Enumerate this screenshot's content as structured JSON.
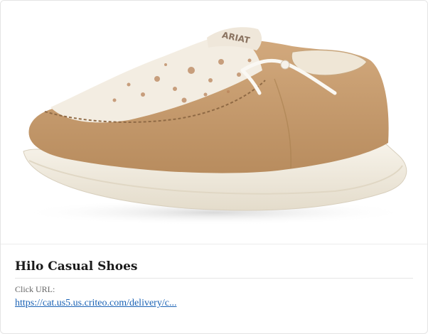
{
  "product": {
    "image_alt": "Ariat Hilo casual shoe, tan suede with cowhide print vamp and white sole",
    "image_brand_text": "ARIAT",
    "title": "Hilo Casual Shoes"
  },
  "link": {
    "label": "Click URL:",
    "text": "https://cat.us5.us.criteo.com/delivery/c..."
  },
  "colors": {
    "suede": "#c49a6c",
    "sole": "#f2ece0",
    "link": "#1a62b5"
  }
}
